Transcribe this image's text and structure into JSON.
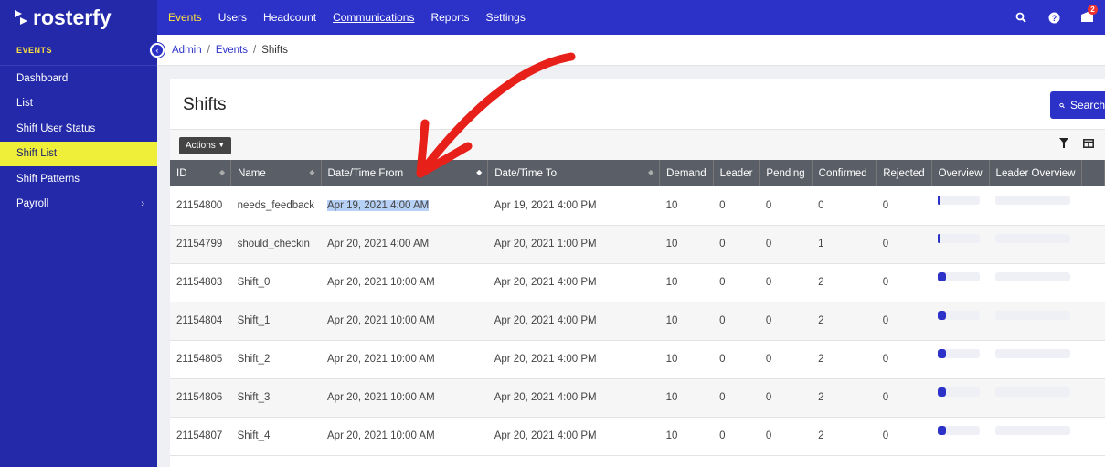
{
  "app": {
    "name": "rosterfy"
  },
  "topnav": {
    "items": [
      {
        "label": "Events",
        "active": true
      },
      {
        "label": "Users"
      },
      {
        "label": "Headcount"
      },
      {
        "label": "Communications",
        "underlined": true
      },
      {
        "label": "Reports"
      },
      {
        "label": "Settings"
      }
    ],
    "notification_count": "2"
  },
  "sidebar": {
    "heading": "EVENTS",
    "items": [
      {
        "label": "Dashboard"
      },
      {
        "label": "List"
      },
      {
        "label": "Shift User Status"
      },
      {
        "label": "Shift List",
        "active": true
      },
      {
        "label": "Shift Patterns"
      },
      {
        "label": "Payroll",
        "has_submenu": true
      }
    ]
  },
  "breadcrumb": {
    "admin": "Admin",
    "events": "Events",
    "current": "Shifts",
    "sep": "/"
  },
  "page": {
    "title": "Shifts",
    "search_label": "Search",
    "actions_label": "Actions"
  },
  "table": {
    "columns": [
      "ID",
      "Name",
      "Date/Time From",
      "Date/Time To",
      "Demand",
      "Leader",
      "Pending",
      "Confirmed",
      "Rejected",
      "Overview",
      "Leader Overview"
    ],
    "rows": [
      {
        "id": "21154800",
        "name": "needs_feedback",
        "from": "Apr 19, 2021 4:00 AM",
        "to": "Apr 19, 2021 4:00 PM",
        "demand": "10",
        "leader": "0",
        "pending": "0",
        "confirmed": "0",
        "rejected": "0",
        "overview": 0.04
      },
      {
        "id": "21154799",
        "name": "should_checkin",
        "from": "Apr 20, 2021 4:00 AM",
        "to": "Apr 20, 2021 1:00 PM",
        "demand": "10",
        "leader": "0",
        "pending": "0",
        "confirmed": "1",
        "rejected": "0",
        "overview": 0.04
      },
      {
        "id": "21154803",
        "name": "Shift_0",
        "from": "Apr 20, 2021 10:00 AM",
        "to": "Apr 20, 2021 4:00 PM",
        "demand": "10",
        "leader": "0",
        "pending": "0",
        "confirmed": "2",
        "rejected": "0",
        "overview": 0.2
      },
      {
        "id": "21154804",
        "name": "Shift_1",
        "from": "Apr 20, 2021 10:00 AM",
        "to": "Apr 20, 2021 4:00 PM",
        "demand": "10",
        "leader": "0",
        "pending": "0",
        "confirmed": "2",
        "rejected": "0",
        "overview": 0.2
      },
      {
        "id": "21154805",
        "name": "Shift_2",
        "from": "Apr 20, 2021 10:00 AM",
        "to": "Apr 20, 2021 4:00 PM",
        "demand": "10",
        "leader": "0",
        "pending": "0",
        "confirmed": "2",
        "rejected": "0",
        "overview": 0.2
      },
      {
        "id": "21154806",
        "name": "Shift_3",
        "from": "Apr 20, 2021 10:00 AM",
        "to": "Apr 20, 2021 4:00 PM",
        "demand": "10",
        "leader": "0",
        "pending": "0",
        "confirmed": "2",
        "rejected": "0",
        "overview": 0.2
      },
      {
        "id": "21154807",
        "name": "Shift_4",
        "from": "Apr 20, 2021 10:00 AM",
        "to": "Apr 20, 2021 4:00 PM",
        "demand": "10",
        "leader": "0",
        "pending": "0",
        "confirmed": "2",
        "rejected": "0",
        "overview": 0.2
      }
    ]
  },
  "colors": {
    "brand": "#2c32c8",
    "sidebar": "#2329a8",
    "active_item": "#efef3a",
    "annotation": "#e8201a"
  }
}
